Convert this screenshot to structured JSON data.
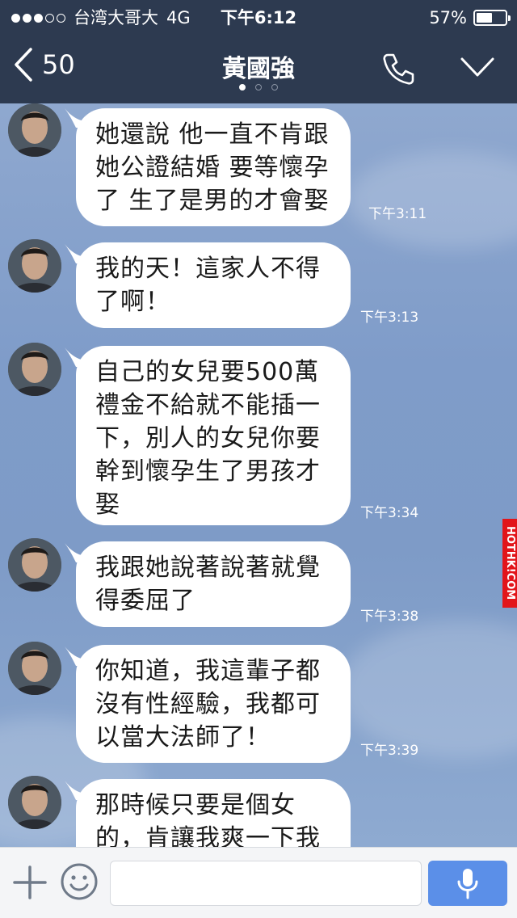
{
  "status": {
    "carrier": "台湾大哥大",
    "network": "4G",
    "time": "下午6:12",
    "battery": "57%",
    "battery_level": 0.57
  },
  "header": {
    "back_count": "50",
    "title": "黃國強"
  },
  "messages": [
    {
      "text": "她還說 他一直不肯跟她公證結婚 要等懷孕了 生了是男的才會娶",
      "time": "下午3:11"
    },
    {
      "text": "我的天！這家人不得了啊！",
      "time": "下午3:13"
    },
    {
      "text": "自己的女兒要500萬禮金不給就不能插一下，別人的女兒你要幹到懷孕生了男孩才娶",
      "time": "下午3:34"
    },
    {
      "text": "我跟她說著說著就覺得委屈了",
      "time": "下午3:38"
    },
    {
      "text": "你知道，我這輩子都沒有性經驗，我都可以當大法師了！",
      "time": "下午3:39"
    },
    {
      "text": "那時候只要是個女的，肯讓我爽一下我",
      "time": ""
    }
  ],
  "watermark": "HOTHK!COM",
  "colors": {
    "header_bg": "#2d3a50",
    "chat_bg": "#829fcb",
    "send_btn": "#5b8fe8"
  },
  "icons": {
    "back": "chevron-left-icon",
    "call": "phone-icon",
    "menu": "chevron-down-icon",
    "plus": "plus-icon",
    "emoji": "smiley-icon",
    "voice": "microphone-icon"
  }
}
